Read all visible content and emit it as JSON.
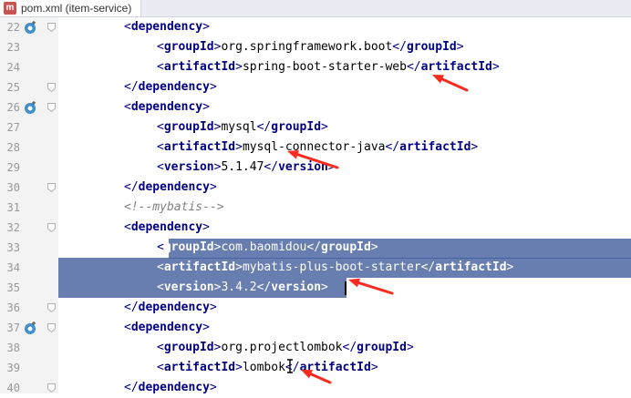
{
  "tab": {
    "icon_letter": "m",
    "title": "pom.xml (item-service)"
  },
  "lines": [
    {
      "num": "22",
      "indent": 0,
      "marker": true,
      "fold": true,
      "parts": [
        [
          "p",
          "<"
        ],
        [
          "tg",
          "dependency"
        ],
        [
          "p",
          ">"
        ]
      ]
    },
    {
      "num": "23",
      "indent": 1,
      "marker": false,
      "fold": false,
      "parts": [
        [
          "p",
          "<"
        ],
        [
          "tg",
          "groupId"
        ],
        [
          "p",
          ">"
        ],
        [
          "tx",
          "org.springframework.boot"
        ],
        [
          "p",
          "</"
        ],
        [
          "tg",
          "groupId"
        ],
        [
          "p",
          ">"
        ]
      ]
    },
    {
      "num": "24",
      "indent": 1,
      "marker": false,
      "fold": false,
      "parts": [
        [
          "p",
          "<"
        ],
        [
          "tg",
          "artifactId"
        ],
        [
          "p",
          ">"
        ],
        [
          "tx",
          "spring-boot-starter-web"
        ],
        [
          "p",
          "</"
        ],
        [
          "tg",
          "artifactId"
        ],
        [
          "p",
          ">"
        ]
      ]
    },
    {
      "num": "25",
      "indent": 0,
      "marker": false,
      "fold": true,
      "parts": [
        [
          "p",
          "</"
        ],
        [
          "tg",
          "dependency"
        ],
        [
          "p",
          ">"
        ]
      ]
    },
    {
      "num": "26",
      "indent": 0,
      "marker": true,
      "fold": true,
      "parts": [
        [
          "p",
          "<"
        ],
        [
          "tg",
          "dependency"
        ],
        [
          "p",
          ">"
        ]
      ]
    },
    {
      "num": "27",
      "indent": 1,
      "marker": false,
      "fold": false,
      "parts": [
        [
          "p",
          "<"
        ],
        [
          "tg",
          "groupId"
        ],
        [
          "p",
          ">"
        ],
        [
          "tx",
          "mysql"
        ],
        [
          "p",
          "</"
        ],
        [
          "tg",
          "groupId"
        ],
        [
          "p",
          ">"
        ]
      ]
    },
    {
      "num": "28",
      "indent": 1,
      "marker": false,
      "fold": false,
      "parts": [
        [
          "p",
          "<"
        ],
        [
          "tg",
          "artifactId"
        ],
        [
          "p",
          ">"
        ],
        [
          "tx",
          "mysql-connector-java"
        ],
        [
          "p",
          "</"
        ],
        [
          "tg",
          "artifactId"
        ],
        [
          "p",
          ">"
        ]
      ]
    },
    {
      "num": "29",
      "indent": 1,
      "marker": false,
      "fold": false,
      "parts": [
        [
          "p",
          "<"
        ],
        [
          "tg",
          "version"
        ],
        [
          "p",
          ">"
        ],
        [
          "tx",
          "5.1.47"
        ],
        [
          "p",
          "</"
        ],
        [
          "tg",
          "version"
        ],
        [
          "p",
          ">"
        ]
      ]
    },
    {
      "num": "30",
      "indent": 0,
      "marker": false,
      "fold": true,
      "parts": [
        [
          "p",
          "</"
        ],
        [
          "tg",
          "dependency"
        ],
        [
          "p",
          ">"
        ]
      ]
    },
    {
      "num": "31",
      "indent": 0,
      "marker": false,
      "fold": false,
      "parts": [
        [
          "cm",
          "<!--mybatis-->"
        ]
      ]
    },
    {
      "num": "32",
      "indent": 0,
      "marker": false,
      "fold": true,
      "parts": [
        [
          "p",
          "<"
        ],
        [
          "tg",
          "dependency"
        ],
        [
          "p",
          ">"
        ]
      ]
    },
    {
      "num": "33",
      "indent": 1,
      "marker": false,
      "fold": false,
      "parts": [
        [
          "p",
          "<"
        ],
        [
          "tg",
          "groupId"
        ],
        [
          "p",
          ">"
        ],
        [
          "tx",
          "com.baomidou"
        ],
        [
          "p",
          "</"
        ],
        [
          "tg",
          "groupId"
        ],
        [
          "p",
          ">"
        ]
      ]
    },
    {
      "num": "34",
      "indent": 1,
      "marker": false,
      "fold": false,
      "parts": [
        [
          "p",
          "<"
        ],
        [
          "tg",
          "artifactId"
        ],
        [
          "p",
          ">"
        ],
        [
          "tx",
          "mybatis-plus-boot-starter"
        ],
        [
          "p",
          "</"
        ],
        [
          "tg",
          "artifactId"
        ],
        [
          "p",
          ">"
        ]
      ]
    },
    {
      "num": "35",
      "indent": 1,
      "marker": false,
      "fold": false,
      "parts": [
        [
          "p",
          "<"
        ],
        [
          "tg",
          "version"
        ],
        [
          "p",
          ">"
        ],
        [
          "tx",
          "3.4.2"
        ],
        [
          "p",
          "</"
        ],
        [
          "tg",
          "version"
        ],
        [
          "p",
          ">"
        ]
      ]
    },
    {
      "num": "36",
      "indent": 0,
      "marker": false,
      "fold": true,
      "parts": [
        [
          "p",
          "</"
        ],
        [
          "tg",
          "dependency"
        ],
        [
          "p",
          ">"
        ]
      ]
    },
    {
      "num": "37",
      "indent": 0,
      "marker": true,
      "fold": true,
      "parts": [
        [
          "p",
          "<"
        ],
        [
          "tg",
          "dependency"
        ],
        [
          "p",
          ">"
        ]
      ]
    },
    {
      "num": "38",
      "indent": 1,
      "marker": false,
      "fold": false,
      "parts": [
        [
          "p",
          "<"
        ],
        [
          "tg",
          "groupId"
        ],
        [
          "p",
          ">"
        ],
        [
          "tx",
          "org.projectlombok"
        ],
        [
          "p",
          "</"
        ],
        [
          "tg",
          "groupId"
        ],
        [
          "p",
          ">"
        ]
      ]
    },
    {
      "num": "39",
      "indent": 1,
      "marker": false,
      "fold": false,
      "parts": [
        [
          "p",
          "<"
        ],
        [
          "tg",
          "artifactId"
        ],
        [
          "p",
          ">"
        ],
        [
          "tx",
          "lombok"
        ],
        [
          "p",
          "</"
        ],
        [
          "tg",
          "artifactId"
        ],
        [
          "p",
          ">"
        ]
      ]
    },
    {
      "num": "40",
      "indent": 0,
      "marker": false,
      "fold": true,
      "parts": [
        [
          "p",
          "</"
        ],
        [
          "tg",
          "dependency"
        ],
        [
          "p",
          ">"
        ]
      ]
    }
  ],
  "colors": {
    "tag": "#000080",
    "comment": "#808080",
    "selection": "#3e5a9a",
    "annotation_arrow": "#ff2a1f",
    "gutter_marker": "#3d8fd0"
  },
  "icons": {
    "tab": "maven-file-icon",
    "marker": "dependency-run-marker-icon",
    "fold": "fold-marker-icon"
  }
}
